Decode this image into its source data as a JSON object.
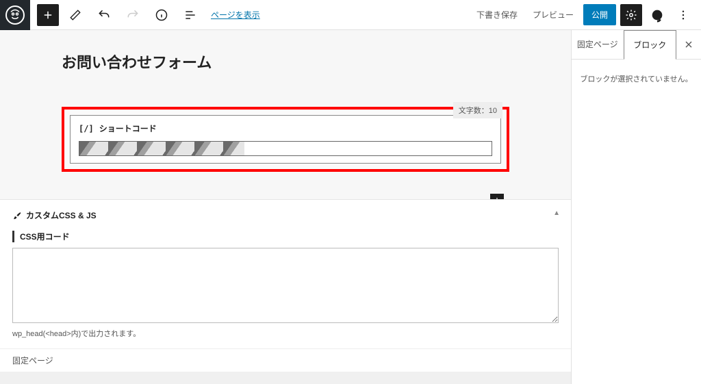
{
  "topbar": {
    "view_page_link": "ページを表示",
    "save_draft": "下書き保存",
    "preview": "プレビュー",
    "publish": "公開"
  },
  "editor": {
    "page_title": "お問い合わせフォーム",
    "word_count_label": "文字数：10",
    "shortcode_block_label": "ショートコード"
  },
  "custom_css_js": {
    "section_title": "カスタムCSS & JS",
    "css_label": "CSS用コード",
    "css_note": "wp_head(<head>内)で出力されます。",
    "textarea_value": ""
  },
  "footer": {
    "label": "固定ページ"
  },
  "sidebar": {
    "tab_page": "固定ページ",
    "tab_block": "ブロック",
    "no_block_selected": "ブロックが選択されていません。"
  }
}
